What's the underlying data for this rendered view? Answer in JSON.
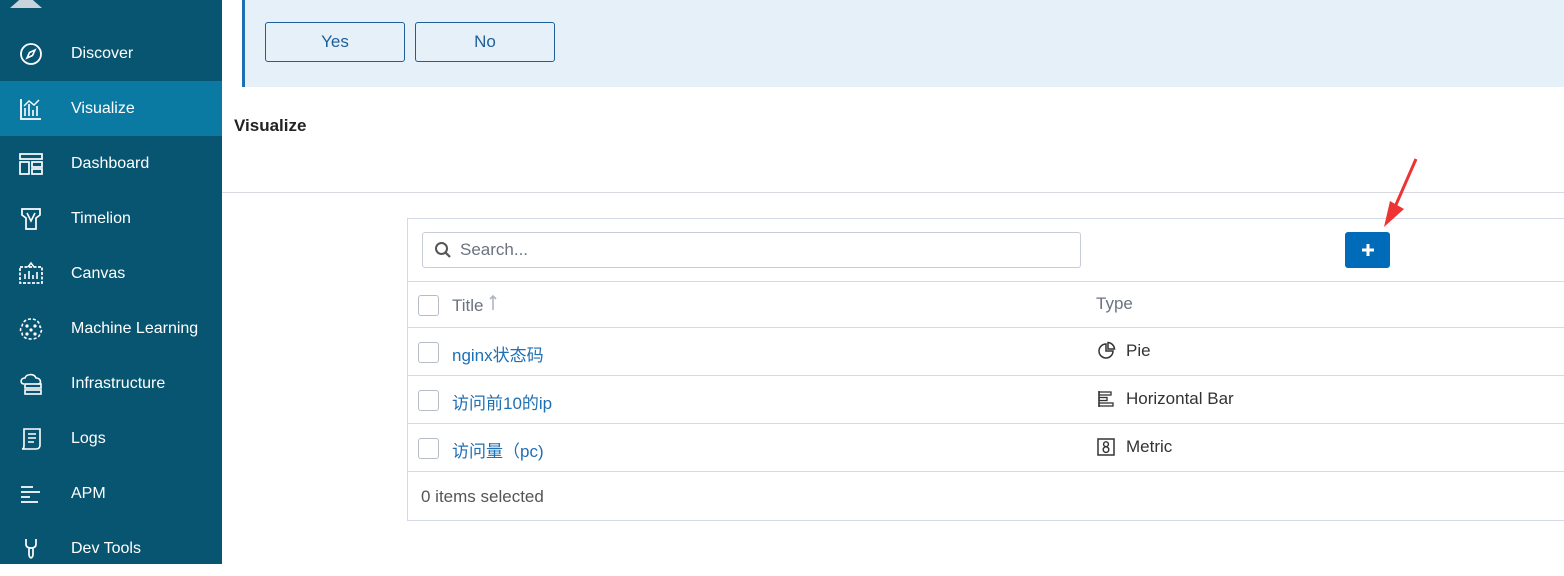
{
  "sidebar": {
    "items": [
      {
        "label": "Discover",
        "icon": "compass-icon"
      },
      {
        "label": "Visualize",
        "icon": "visualize-icon",
        "active": true
      },
      {
        "label": "Dashboard",
        "icon": "dashboard-icon"
      },
      {
        "label": "Timelion",
        "icon": "timelion-icon"
      },
      {
        "label": "Canvas",
        "icon": "canvas-icon"
      },
      {
        "label": "Machine Learning",
        "icon": "machine-learning-icon"
      },
      {
        "label": "Infrastructure",
        "icon": "infrastructure-icon"
      },
      {
        "label": "Logs",
        "icon": "logs-icon"
      },
      {
        "label": "APM",
        "icon": "apm-icon"
      },
      {
        "label": "Dev Tools",
        "icon": "dev-tools-icon"
      }
    ]
  },
  "banner": {
    "yes_label": "Yes",
    "no_label": "No"
  },
  "page": {
    "title": "Visualize"
  },
  "search": {
    "placeholder": "Search...",
    "value": ""
  },
  "table": {
    "columns": {
      "title": "Title",
      "type": "Type"
    },
    "rows": [
      {
        "title": "nginx状态码",
        "type": "Pie",
        "type_icon": "pie-icon"
      },
      {
        "title": "访问前10的ip",
        "type": "Horizontal Bar",
        "type_icon": "horizontal-bar-icon"
      },
      {
        "title": "访问量（pc)",
        "type": "Metric",
        "type_icon": "metric-icon"
      }
    ],
    "footer": "0 items selected"
  },
  "colors": {
    "sidebar_bg": "#085571",
    "sidebar_active": "#0a7aa3",
    "accent": "#006bb8",
    "link": "#1f6fb3",
    "annotation_arrow": "#ee3333"
  }
}
